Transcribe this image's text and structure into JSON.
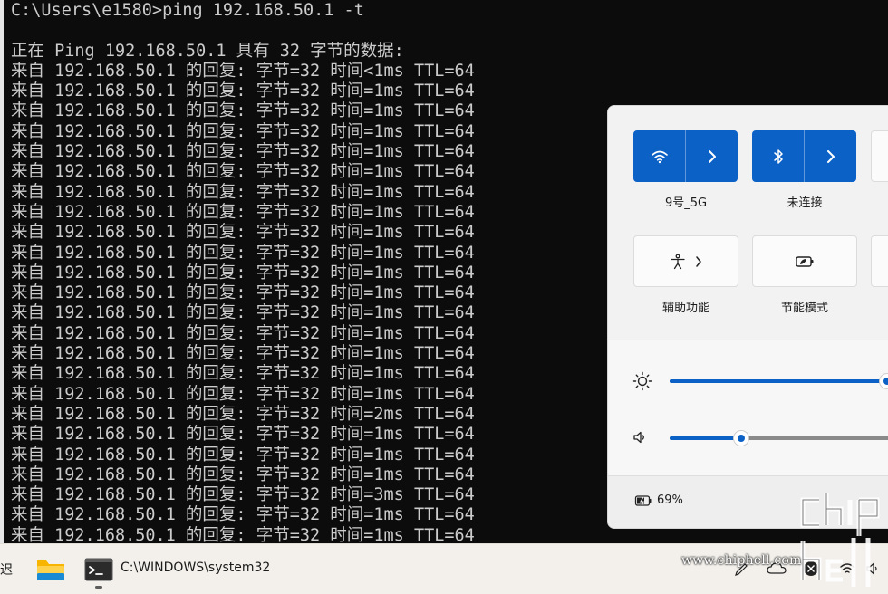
{
  "terminal": {
    "lines": [
      "C:\\Users\\e1580>ping 192.168.50.1 -t",
      "",
      "正在 Ping 192.168.50.1 具有 32 字节的数据:",
      "来自 192.168.50.1 的回复: 字节=32 时间<1ms TTL=64",
      "来自 192.168.50.1 的回复: 字节=32 时间=1ms TTL=64",
      "来自 192.168.50.1 的回复: 字节=32 时间=1ms TTL=64",
      "来自 192.168.50.1 的回复: 字节=32 时间=1ms TTL=64",
      "来自 192.168.50.1 的回复: 字节=32 时间=1ms TTL=64",
      "来自 192.168.50.1 的回复: 字节=32 时间=1ms TTL=64",
      "来自 192.168.50.1 的回复: 字节=32 时间=1ms TTL=64",
      "来自 192.168.50.1 的回复: 字节=32 时间=1ms TTL=64",
      "来自 192.168.50.1 的回复: 字节=32 时间=1ms TTL=64",
      "来自 192.168.50.1 的回复: 字节=32 时间=1ms TTL=64",
      "来自 192.168.50.1 的回复: 字节=32 时间=1ms TTL=64",
      "来自 192.168.50.1 的回复: 字节=32 时间=1ms TTL=64",
      "来自 192.168.50.1 的回复: 字节=32 时间=1ms TTL=64",
      "来自 192.168.50.1 的回复: 字节=32 时间=1ms TTL=64",
      "来自 192.168.50.1 的回复: 字节=32 时间=1ms TTL=64",
      "来自 192.168.50.1 的回复: 字节=32 时间=1ms TTL=64",
      "来自 192.168.50.1 的回复: 字节=32 时间=1ms TTL=64",
      "来自 192.168.50.1 的回复: 字节=32 时间=2ms TTL=64",
      "来自 192.168.50.1 的回复: 字节=32 时间=1ms TTL=64",
      "来自 192.168.50.1 的回复: 字节=32 时间=1ms TTL=64",
      "来自 192.168.50.1 的回复: 字节=32 时间=1ms TTL=64",
      "来自 192.168.50.1 的回复: 字节=32 时间=3ms TTL=64",
      "来自 192.168.50.1 的回复: 字节=32 时间=1ms TTL=64",
      "来自 192.168.50.1 的回复: 字节=32 时间=1ms TTL=64"
    ]
  },
  "quick_settings": {
    "wifi": {
      "label": "9号_5G",
      "icon": "wifi-icon",
      "state": "on"
    },
    "bluetooth": {
      "label": "未连接",
      "icon": "bluetooth-icon",
      "state": "on"
    },
    "accessibility": {
      "label": "辅助功能",
      "icon": "accessibility-icon"
    },
    "battery_saver": {
      "label": "节能模式",
      "icon": "battery-saver-icon"
    },
    "brightness": {
      "icon": "brightness-icon",
      "level": 1.0
    },
    "volume": {
      "icon": "volume-icon",
      "level": 0.3
    },
    "battery": {
      "icon": "battery-charging-icon",
      "text": "69%"
    }
  },
  "taskbar": {
    "left_text": "迟",
    "apps": [
      {
        "name": "file-explorer",
        "icon": "folder-icon"
      },
      {
        "name": "cmd",
        "icon": "terminal-icon",
        "label": "C:\\WINDOWS\\system32"
      }
    ]
  },
  "watermark": {
    "url": "www.chiphell.com"
  },
  "colors": {
    "accent": "#0b61c6",
    "terminal_bg": "#0c0c0c",
    "terminal_fg": "#cccccc"
  }
}
